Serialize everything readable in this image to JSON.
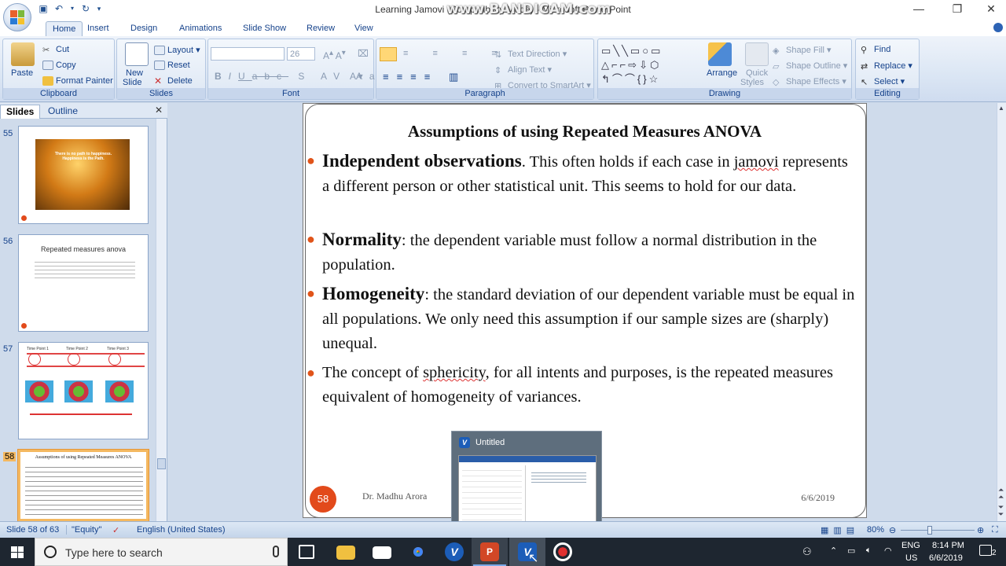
{
  "window": {
    "title": "Learning Jamovi (Compatibility Mode) - Microsoft PowerPoint",
    "watermark": "www.BANDICAM.com"
  },
  "ribbon_tabs": [
    "Home",
    "Insert",
    "Design",
    "Animations",
    "Slide Show",
    "Review",
    "View"
  ],
  "ribbon": {
    "clipboard": {
      "label": "Clipboard",
      "paste": "Paste",
      "cut": "Cut",
      "copy": "Copy",
      "format_painter": "Format Painter"
    },
    "slides": {
      "label": "Slides",
      "new_slide_1": "New",
      "new_slide_2": "Slide",
      "layout": "Layout",
      "reset": "Reset",
      "delete": "Delete"
    },
    "font": {
      "label": "Font",
      "size": "26"
    },
    "paragraph": {
      "label": "Paragraph",
      "text_direction": "Text Direction",
      "align_text": "Align Text",
      "convert_smartart": "Convert to SmartArt"
    },
    "drawing": {
      "label": "Drawing",
      "arrange": "Arrange",
      "quick_styles_1": "Quick",
      "quick_styles_2": "Styles",
      "shape_fill": "Shape Fill",
      "shape_outline": "Shape Outline",
      "shape_effects": "Shape Effects"
    },
    "editing": {
      "label": "Editing",
      "find": "Find",
      "replace": "Replace",
      "select": "Select"
    }
  },
  "pane_tabs": {
    "slides": "Slides",
    "outline": "Outline"
  },
  "thumbnails": [
    {
      "num": "55",
      "text": "There is no path to happiness. Happiness is the Path."
    },
    {
      "num": "56",
      "title": "Repeated measures anova"
    },
    {
      "num": "57",
      "labels": [
        "Time Point 1",
        "Time Point 2",
        "Time Point 3"
      ]
    },
    {
      "num": "58",
      "title": "Assumptions of using Repeated Measures ANOVA"
    }
  ],
  "slide": {
    "title": "Assumptions of using  Repeated Measures ANOVA",
    "b1_head": "Independent observations",
    "b1_a": ". This often holds if each case in ",
    "b1_link": "jamovi",
    "b1_b": " represents a different person or other statistical unit. This seems to hold for our data.",
    "b2_head": "Normality",
    "b2_text": ": the dependent variable must follow a normal distribution in the population.",
    "b3_head": "Homogeneity",
    "b3_text": ": the standard deviation of our dependent variable must be equal in all populations. We only need this assumption if our sample sizes are (sharply) unequal.",
    "b4_a": "The concept of ",
    "b4_link": "sphericity",
    "b4_b": ", for all intents and purposes, is the repeated measures equivalent of homogeneity of variances.",
    "number": "58",
    "author": "Dr. Madhu Arora",
    "date": "6/6/2019"
  },
  "preview": {
    "title": "Untitled"
  },
  "status": {
    "slide_of": "Slide 58 of 63",
    "theme": "\"Equity\"",
    "language": "English (United States)",
    "zoom": "80%"
  },
  "taskbar": {
    "search_placeholder": "Type here to search",
    "lang_1": "ENG",
    "lang_2": "US",
    "time": "8:14 PM",
    "date": "6/6/2019",
    "notif_count": "2"
  }
}
